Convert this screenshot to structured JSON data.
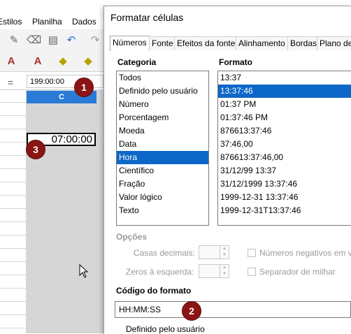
{
  "spreadsheet": {
    "menu": [
      "Estilos",
      "Planilha",
      "Dados"
    ],
    "formula_value": "199:00:00",
    "column_header": "C",
    "active_cell_value": "07:00:00"
  },
  "badges": [
    "1",
    "2",
    "3"
  ],
  "dialog": {
    "title": "Formatar células",
    "tabs": [
      "Números",
      "Fonte",
      "Efeitos da fonte",
      "Alinhamento",
      "Bordas",
      "Plano de"
    ],
    "category_label": "Categoria",
    "categories": [
      "Todos",
      "Definido pelo usuário",
      "Número",
      "Porcentagem",
      "Moeda",
      "Data",
      "Hora",
      "Científico",
      "Fração",
      "Valor lógico",
      "Texto"
    ],
    "selected_category": "Hora",
    "format_label": "Formato",
    "formats": [
      "13:37",
      "13:37:46",
      "01:37 PM",
      "01:37:46 PM",
      "876613:37:46",
      "37:46,00",
      "876613:37:46,00",
      "31/12/99 13:37",
      "31/12/1999 13:37:46",
      "1999-12-31 13:37:46",
      "1999-12-31T13:37:46"
    ],
    "selected_format": "13:37:46",
    "options_label": "Opções",
    "decimal_places_label": "Casas decimais:",
    "leading_zeros_label": "Zeros à esquerda:",
    "negative_red_label": "Números negativos em v",
    "thousands_sep_label": "Separador de milhar",
    "format_code_label": "Código do formato",
    "format_code_value": "HH:MM:SS",
    "format_code_description": "Definido pelo usuário"
  },
  "colors": {
    "selection": "#0d67c9",
    "column_header": "#2a7bd5",
    "badge": "#8b1414"
  }
}
